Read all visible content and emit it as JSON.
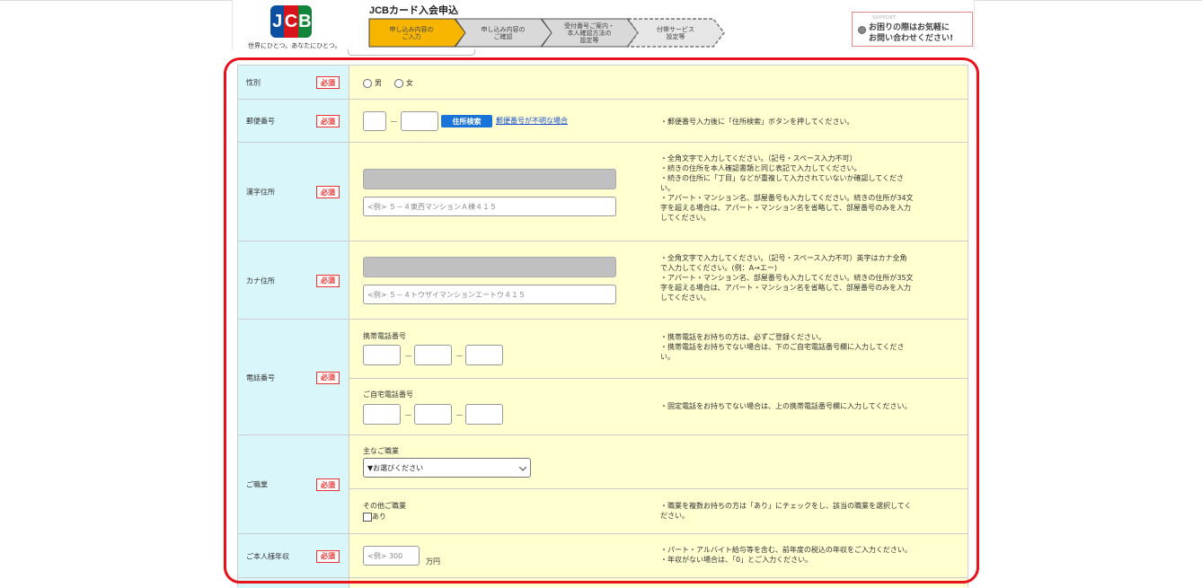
{
  "header": {
    "brand_letters": [
      "J",
      "C",
      "B"
    ],
    "slogan": "世界にひとつ。あなたにひとつ。",
    "title": "JCBカード入会申込",
    "steps": [
      {
        "line1": "申し込み内容の",
        "line2": "ご入力",
        "active": true
      },
      {
        "line1": "申し込み内容の",
        "line2": "ご確認",
        "active": false
      },
      {
        "line1": "受付番号ご案内・",
        "line2": "本人確認方法の",
        "line3": "設定等",
        "active": false
      },
      {
        "line1": "付帯サービス",
        "line2": "設定等",
        "active": false
      }
    ],
    "help": {
      "sup": "SUPPORT",
      "line1": "お困りの際はお気軽に",
      "line2": "お問い合わせください!"
    }
  },
  "required_label": "必須",
  "gender": {
    "label": "性別",
    "options": [
      "男",
      "女"
    ]
  },
  "postal": {
    "label": "郵便番号",
    "separator": "－",
    "search_button": "住所検索",
    "unknown_link": "郵便番号が不明な場合",
    "note": "・郵便番号入力後に「住所検索」ボタンを押してください。"
  },
  "kanji_address": {
    "label": "漢字住所",
    "placeholder": "<例> ５－４東西マンションＡ棟４１５",
    "note": [
      "・全角文字で入力してください。（記号・スペース入力不可）",
      "・続きの住所を本人確認書類と同じ表記で入力してください。",
      "・続きの住所に「丁目」などが重複して入力されていないか確認してくださ",
      "い。",
      "・アパート・マンション名、部屋番号も入力してください。続きの住所が34文",
      "字を超える場合は、アパート・マンション名を省略して、部屋番号のみを入力",
      "してください。"
    ]
  },
  "kana_address": {
    "label": "カナ住所",
    "placeholder": "<例> ５－４トウザイマンションエートウ４１５",
    "note": [
      "・全角文字で入力してください。（記号・スペース入力不可）英字はカナ全角",
      "で入力してください。(例：A→エー)",
      "・アパート・マンション名、部屋番号も入力してください。続きの住所が35文",
      "字を超える場合は、アパート・マンション名を省略して、部屋番号のみを入力",
      "してください。"
    ]
  },
  "phone": {
    "label": "電話番号",
    "separator": "－",
    "mobile": {
      "label": "携帯電話番号",
      "note": [
        "・携帯電話をお持ちの方は、必ずご登録ください。",
        "・携帯電話をお持ちでない場合は、下のご自宅電話番号欄に入力してくださ",
        "い。"
      ]
    },
    "home": {
      "label": "ご自宅電話番号",
      "note": [
        "・固定電話をお持ちでない場合は、上の携帯電話番号欄に入力してください。"
      ]
    }
  },
  "occupation": {
    "label": "ご職業",
    "main_label": "主なご職業",
    "main_selected": "▼お選びください",
    "other_label": "その他ご職業",
    "other_check": "あり",
    "note": [
      "・職業を複数お持ちの方は「あり」にチェックをし、該当の職業を選択してく",
      "ださい。"
    ]
  },
  "income": {
    "label": "ご本人様年収",
    "placeholder": "<例> 300",
    "unit": "万円",
    "note": [
      "・パート・アルバイト給与等を含む、前年度の税込の年収をご入力ください。",
      "・年収がない場合は、「0」とご入力ください。"
    ]
  }
}
